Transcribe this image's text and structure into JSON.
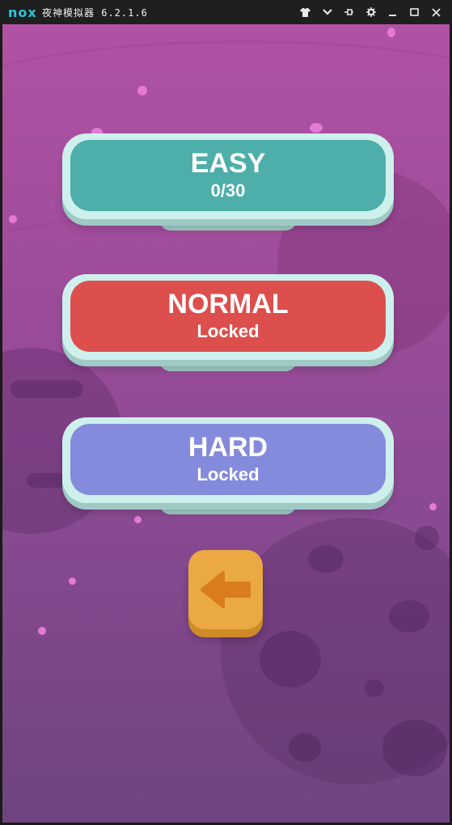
{
  "window": {
    "brand": "nox",
    "title": "夜神模拟器 6.2.1.6",
    "controls": [
      "shirt-icon",
      "chevron-down-icon",
      "pin-icon",
      "gear-icon",
      "minimize-icon",
      "maximize-icon",
      "close-icon"
    ]
  },
  "levels": [
    {
      "name": "EASY",
      "status": "0/30",
      "color": "#4daeaa"
    },
    {
      "name": "NORMAL",
      "status": "Locked",
      "color": "#dc4f4c"
    },
    {
      "name": "HARD",
      "status": "Locked",
      "color": "#848bdc"
    }
  ],
  "back_button": {
    "icon": "arrow-left-icon",
    "color": "#eaa943"
  }
}
